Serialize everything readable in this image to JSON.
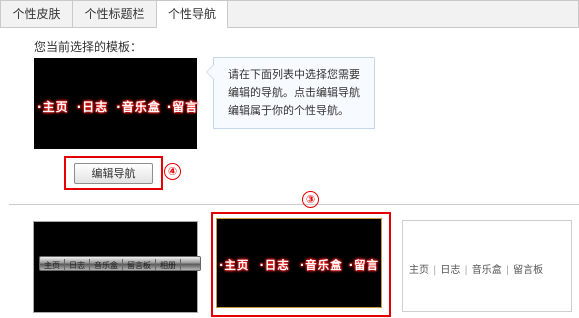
{
  "tabs": [
    {
      "label": "个性皮肤",
      "active": false
    },
    {
      "label": "个性标题栏",
      "active": false
    },
    {
      "label": "个性导航",
      "active": true
    }
  ],
  "current_template_label": "您当前选择的模板：",
  "nav_items": [
    "主页",
    "日志",
    "音乐盒",
    "留言"
  ],
  "tooltip": "请在下面列表中选择您需要编辑的导航。点击编辑导航编辑属于你的个性导航。",
  "edit_button": "编辑导航",
  "annotations": {
    "circle4": "④",
    "circle3": "③"
  },
  "template1_items": [
    "主页",
    "日志",
    "音乐盒",
    "留言板",
    "相册"
  ],
  "template2_items": [
    "主页",
    "日志",
    "音乐盒",
    "留言"
  ],
  "template3_items": [
    "主页",
    "日志",
    "音乐盒",
    "留言板"
  ],
  "colors": {
    "highlight": "#e60000",
    "tab_bg": "#f2f2f2",
    "tip_border": "#c5d6e8"
  }
}
